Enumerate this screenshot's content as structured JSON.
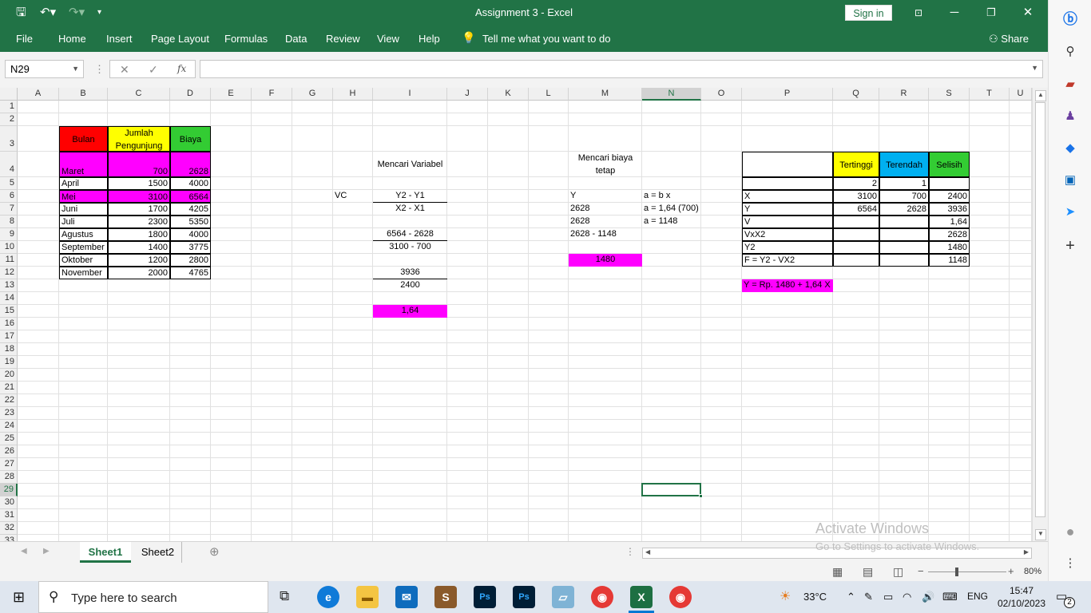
{
  "titlebar": {
    "title": "Assignment 3  -  Excel",
    "sign_in": "Sign in"
  },
  "menu": [
    "File",
    "Home",
    "Insert",
    "Page Layout",
    "Formulas",
    "Data",
    "Review",
    "View",
    "Help"
  ],
  "tell_me": "Tell me what you want to do",
  "share": "Share",
  "namebox": "N29",
  "columns": [
    "A",
    "B",
    "C",
    "D",
    "E",
    "F",
    "G",
    "H",
    "I",
    "J",
    "K",
    "L",
    "M",
    "N",
    "O",
    "P",
    "Q",
    "R",
    "S",
    "T",
    "U"
  ],
  "selected_column": "N",
  "selected_row": 29,
  "cells": {
    "b3": "Bulan",
    "c3": "Jumlah Pengunjung",
    "d3": "Biaya",
    "b4": "Maret",
    "c4": "700",
    "d4": "2628",
    "b5": "April",
    "c5": "1500",
    "d5": "4000",
    "b6": "Mei",
    "c6": "3100",
    "d6": "6564",
    "b7": "Juni",
    "c7": "1700",
    "d7": "4205",
    "b8": "Juli",
    "c8": "2300",
    "d8": "5350",
    "b9": "Agustus",
    "c9": "1800",
    "d9": "4000",
    "b10": "September",
    "c10": "1400",
    "d10": "3775",
    "b11": "Oktober",
    "c11": "1200",
    "d11": "2800",
    "b12": "November",
    "c12": "2000",
    "d12": "4765",
    "i4": "Mencari Variabel",
    "h6": "VC",
    "i6": "Y2 - Y1",
    "i7": "X2 - X1",
    "i9": "6564 - 2628",
    "i10": "3100 - 700",
    "i12": "3936",
    "i13": "2400",
    "i15": "1,64",
    "m4": "Mencari biaya tetap",
    "m6": "Y",
    "n6": "a = b x",
    "m7": "2628",
    "n7": "a = 1,64 (700)",
    "m8": "2628",
    "n8": "a = 1148",
    "m9": "2628 - 1148",
    "m11": "1480",
    "q4": "Tertinggi",
    "r4": "Terendah",
    "s4": "Selisih",
    "q5": "2",
    "r5": "1",
    "p6": "X",
    "q6": "3100",
    "r6": "700",
    "s6": "2400",
    "p7": "Y",
    "q7": "6564",
    "r7": "2628",
    "s7": "3936",
    "p8": "V",
    "s8": "1,64",
    "p9": "VxX2",
    "s9": "2628",
    "p10": "Y2",
    "s10": "1480",
    "p11": "F = Y2 - VX2",
    "s11": "1148",
    "p13": "Y = Rp. 1480 + 1,64 X"
  },
  "colors": {
    "excel_green": "#217346",
    "header_red": "#ff0000",
    "header_yellow": "#ffff00",
    "header_green": "#33cc33",
    "magenta": "#ff00ff",
    "cyan": "#00b0f0"
  },
  "sheets": {
    "tab1": "Sheet1",
    "tab2": "Sheet2"
  },
  "status": {
    "zoom": "80%"
  },
  "watermark": {
    "line1": "Activate Windows",
    "line2": "Go to Settings to activate Windows."
  },
  "taskbar": {
    "search_placeholder": "Type here to search",
    "temperature": "33°C",
    "language": "ENG",
    "time": "15:47",
    "date": "02/10/2023",
    "notifications": "2"
  }
}
